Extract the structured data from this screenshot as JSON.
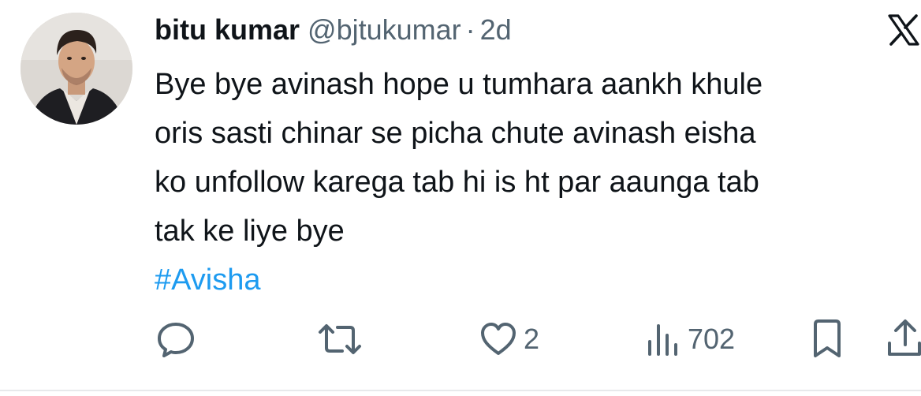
{
  "tweet": {
    "author": {
      "name": "bitu kumar",
      "handle": "@bjtukumar",
      "separator": "·",
      "time": "2d"
    },
    "lines": [
      "Bye bye avinash hope u tumhara aankh khule",
      "oris sasti chinar se picha chute avinash eisha",
      "ko unfollow karega tab hi is ht par aaunga tab",
      "tak ke liye bye"
    ],
    "hashtag": "#Avisha",
    "actions": {
      "reply_icon": "reply-icon",
      "retweet_icon": "retweet-icon",
      "like_icon": "heart-icon",
      "likes": "2",
      "views_icon": "views-icon",
      "views": "702",
      "bookmark_icon": "bookmark-icon",
      "share_icon": "share-icon"
    },
    "colors": {
      "text": "#0f1419",
      "secondary": "#536471",
      "link": "#1d9bf0"
    }
  }
}
